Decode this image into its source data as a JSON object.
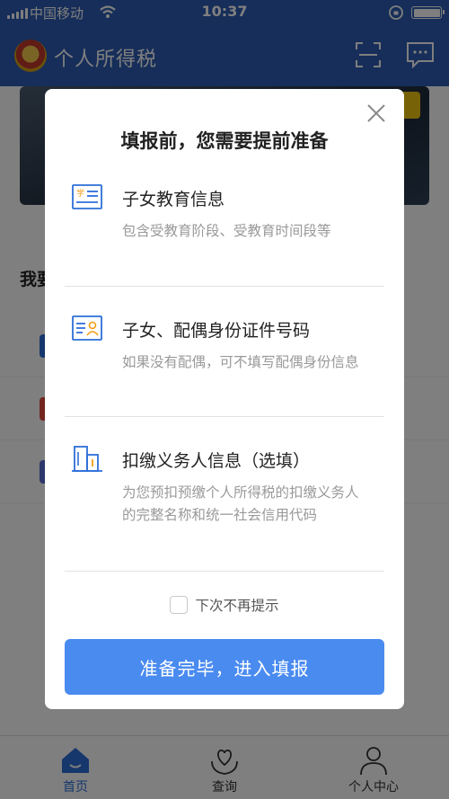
{
  "status_bar": {
    "carrier": "中国移动",
    "time": "10:37"
  },
  "app_bar": {
    "title": "个人所得税",
    "scan_icon": "scan-icon",
    "message_icon": "message-icon"
  },
  "section": {
    "title": "我要"
  },
  "tab_bar": {
    "items": [
      {
        "label": "首页",
        "icon": "home-icon",
        "active": true
      },
      {
        "label": "查询",
        "icon": "heart-hands-icon",
        "active": false
      },
      {
        "label": "个人中心",
        "icon": "person-icon",
        "active": false
      }
    ]
  },
  "dialog": {
    "title": "填报前，您需要提前准备",
    "items": [
      {
        "icon": "education-doc-icon",
        "title": "子女教育信息",
        "description": "包含受教育阶段、受教育时间段等"
      },
      {
        "icon": "id-card-icon",
        "title": "子女、配偶身份证件号码",
        "description": "如果没有配偶，可不填写配偶身份信息"
      },
      {
        "icon": "building-icon",
        "title": "扣缴义务人信息（选填）",
        "description": "为您预扣预缴个人所得税的扣缴义务人的完整名称和统一社会信用代码"
      }
    ],
    "dont_show_label": "下次不再提示",
    "confirm_label": "准备完毕，进入填报",
    "accent_color": "#4a8bf0",
    "icon_color": "#2d6fd8"
  }
}
